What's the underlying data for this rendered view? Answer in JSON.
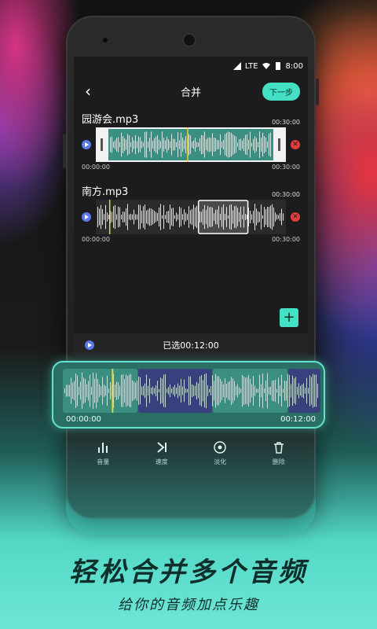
{
  "statusbar": {
    "network": "LTE",
    "time": "8:00"
  },
  "nav": {
    "title": "合并",
    "next_label": "下一步"
  },
  "tracks": [
    {
      "name": "园游会.mp3",
      "duration": "00:30:00",
      "start_time": "00:00:00",
      "end_time": "00:30:00",
      "playhead": 0.48,
      "selection": [
        0.0,
        1.0
      ]
    },
    {
      "name": "南方.mp3",
      "duration": "00:30:00",
      "start_time": "00:00:00",
      "end_time": "00:30:00",
      "playhead": 0.07,
      "selection": [
        0.54,
        0.8
      ]
    }
  ],
  "selected": {
    "label": "已选00:12:00"
  },
  "merged": {
    "start_time": "00:00:00",
    "end_time": "00:12:00",
    "playhead": 0.19
  },
  "toolbar": {
    "items": [
      {
        "label": "音量",
        "icon": "volume-bars-icon"
      },
      {
        "label": "速度",
        "icon": "speed-skip-icon"
      },
      {
        "label": "淡化",
        "icon": "fade-circle-icon"
      },
      {
        "label": "删除",
        "icon": "trash-icon"
      }
    ]
  },
  "promo": {
    "headline": "轻松合并多个音频",
    "subline": "给你的音频加点乐趣"
  },
  "colors": {
    "accent": "#44e0c4",
    "play": "#5a7bea",
    "delete": "#e43d3d",
    "playhead": "#e5d23a",
    "wave_teal": "#3b8f80",
    "wave_blue": "#38407e"
  }
}
